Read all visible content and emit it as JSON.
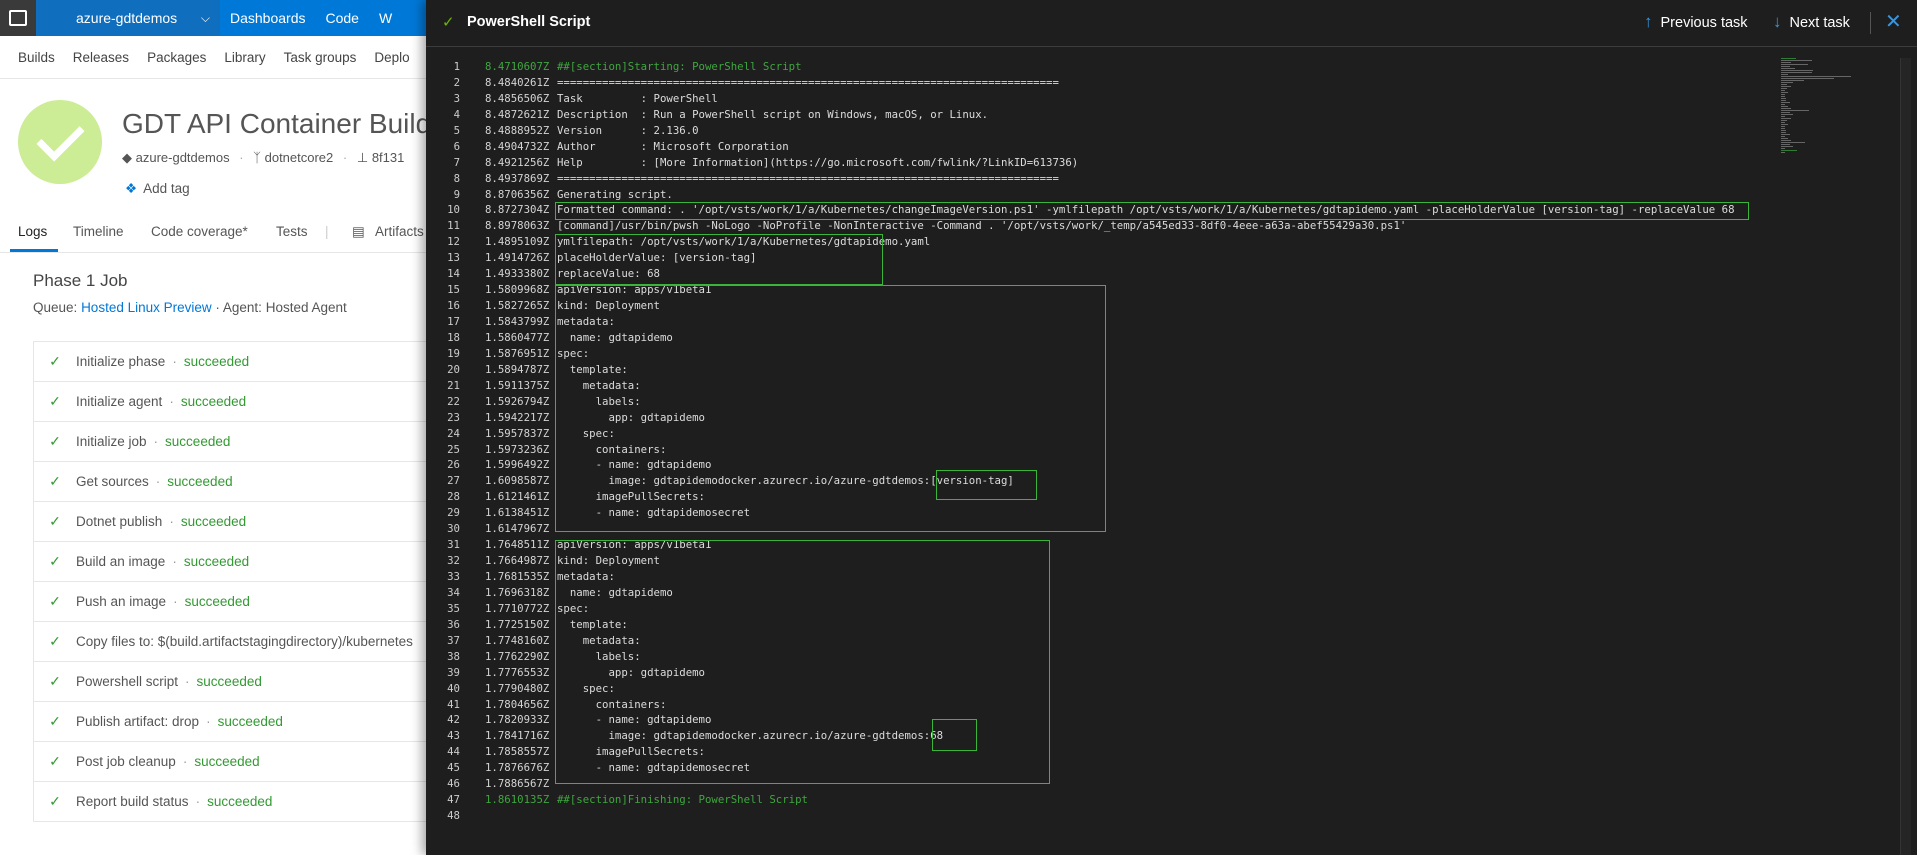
{
  "topbar": {
    "project": "azure-gdtdemos",
    "nav": [
      "Dashboards",
      "Code",
      "W"
    ]
  },
  "subnav": [
    "Builds",
    "Releases",
    "Packages",
    "Library",
    "Task groups",
    "Deplo"
  ],
  "build": {
    "title": "GDT API Container Build",
    "meta_project": "azure-gdtdemos",
    "meta_branch": "dotnetcore2",
    "meta_commit": "8f131",
    "add_tag": "Add tag"
  },
  "tabs": [
    "Logs",
    "Timeline",
    "Code coverage*",
    "Tests",
    "Artifacts"
  ],
  "phase": {
    "title": "Phase 1 Job",
    "queue_label": "Queue:",
    "queue_link": "Hosted Linux Preview",
    "agent": "· Agent: Hosted Agent"
  },
  "tasks": [
    {
      "name": "Initialize phase",
      "status": "succeeded"
    },
    {
      "name": "Initialize agent",
      "status": "succeeded"
    },
    {
      "name": "Initialize job",
      "status": "succeeded"
    },
    {
      "name": "Get sources",
      "status": "succeeded"
    },
    {
      "name": "Dotnet publish",
      "status": "succeeded"
    },
    {
      "name": "Build an image",
      "status": "succeeded"
    },
    {
      "name": "Push an image",
      "status": "succeeded"
    },
    {
      "name": "Copy files to: $(build.artifactstagingdirectory)/kubernetes",
      "status": ""
    },
    {
      "name": "Powershell script",
      "status": "succeeded"
    },
    {
      "name": "Publish artifact: drop",
      "status": "succeeded"
    },
    {
      "name": "Post job cleanup",
      "status": "succeeded"
    },
    {
      "name": "Report build status",
      "status": "succeeded"
    }
  ],
  "log_panel": {
    "title": "PowerShell Script",
    "prev_task": "Previous task",
    "next_task": "Next task",
    "lines": [
      {
        "n": "1",
        "ts": "8.4710607Z",
        "text": "##[section]Starting: PowerShell Script",
        "section": true
      },
      {
        "n": "2",
        "ts": "8.4840261Z",
        "text": "=============================================================================="
      },
      {
        "n": "3",
        "ts": "8.4856506Z",
        "text": "Task         : PowerShell"
      },
      {
        "n": "4",
        "ts": "8.4872621Z",
        "text": "Description  : Run a PowerShell script on Windows, macOS, or Linux."
      },
      {
        "n": "5",
        "ts": "8.4888952Z",
        "text": "Version      : 2.136.0"
      },
      {
        "n": "6",
        "ts": "8.4904732Z",
        "text": "Author       : Microsoft Corporation"
      },
      {
        "n": "7",
        "ts": "8.4921256Z",
        "text": "Help         : [More Information](https://go.microsoft.com/fwlink/?LinkID=613736)"
      },
      {
        "n": "8",
        "ts": "8.4937869Z",
        "text": "=============================================================================="
      },
      {
        "n": "9",
        "ts": "8.8706356Z",
        "text": "Generating script."
      },
      {
        "n": "10",
        "ts": "8.8727304Z",
        "text": "Formatted command: . '/opt/vsts/work/1/a/Kubernetes/changeImageVersion.ps1' -ymlfilepath /opt/vsts/work/1/a/Kubernetes/gdtapidemo.yaml -placeHolderValue [version-tag] -replaceValue 68"
      },
      {
        "n": "11",
        "ts": "8.8978063Z",
        "text": "[command]/usr/bin/pwsh -NoLogo -NoProfile -NonInteractive -Command . '/opt/vsts/work/_temp/a545ed33-8df0-4eee-a63a-abef55429a30.ps1'"
      },
      {
        "n": "12",
        "ts": "1.4895109Z",
        "text": "ymlfilepath: /opt/vsts/work/1/a/Kubernetes/gdtapidemo.yaml"
      },
      {
        "n": "13",
        "ts": "1.4914726Z",
        "text": "placeHolderValue: [version-tag]"
      },
      {
        "n": "14",
        "ts": "1.4933380Z",
        "text": "replaceValue: 68"
      },
      {
        "n": "15",
        "ts": "1.5809968Z",
        "text": "apiVersion: apps/v1beta1"
      },
      {
        "n": "16",
        "ts": "1.5827265Z",
        "text": "kind: Deployment"
      },
      {
        "n": "17",
        "ts": "1.5843799Z",
        "text": "metadata:"
      },
      {
        "n": "18",
        "ts": "1.5860477Z",
        "text": "  name: gdtapidemo"
      },
      {
        "n": "19",
        "ts": "1.5876951Z",
        "text": "spec:"
      },
      {
        "n": "20",
        "ts": "1.5894787Z",
        "text": "  template:"
      },
      {
        "n": "21",
        "ts": "1.5911375Z",
        "text": "    metadata:"
      },
      {
        "n": "22",
        "ts": "1.5926794Z",
        "text": "      labels:"
      },
      {
        "n": "23",
        "ts": "1.5942217Z",
        "text": "        app: gdtapidemo"
      },
      {
        "n": "24",
        "ts": "1.5957837Z",
        "text": "    spec:"
      },
      {
        "n": "25",
        "ts": "1.5973236Z",
        "text": "      containers:"
      },
      {
        "n": "26",
        "ts": "1.5996492Z",
        "text": "      - name: gdtapidemo"
      },
      {
        "n": "27",
        "ts": "1.6098587Z",
        "text": "        image: gdtapidemodocker.azurecr.io/azure-gdtdemos:[version-tag]"
      },
      {
        "n": "28",
        "ts": "1.6121461Z",
        "text": "      imagePullSecrets:"
      },
      {
        "n": "29",
        "ts": "1.6138451Z",
        "text": "      - name: gdtapidemosecret"
      },
      {
        "n": "30",
        "ts": "1.6147967Z",
        "text": ""
      },
      {
        "n": "31",
        "ts": "1.7648511Z",
        "text": "apiVersion: apps/v1beta1"
      },
      {
        "n": "32",
        "ts": "1.7664987Z",
        "text": "kind: Deployment"
      },
      {
        "n": "33",
        "ts": "1.7681535Z",
        "text": "metadata:"
      },
      {
        "n": "34",
        "ts": "1.7696318Z",
        "text": "  name: gdtapidemo"
      },
      {
        "n": "35",
        "ts": "1.7710772Z",
        "text": "spec:"
      },
      {
        "n": "36",
        "ts": "1.7725150Z",
        "text": "  template:"
      },
      {
        "n": "37",
        "ts": "1.7748160Z",
        "text": "    metadata:"
      },
      {
        "n": "38",
        "ts": "1.7762290Z",
        "text": "      labels:"
      },
      {
        "n": "39",
        "ts": "1.7776553Z",
        "text": "        app: gdtapidemo"
      },
      {
        "n": "40",
        "ts": "1.7790480Z",
        "text": "    spec:"
      },
      {
        "n": "41",
        "ts": "1.7804656Z",
        "text": "      containers:"
      },
      {
        "n": "42",
        "ts": "1.7820933Z",
        "text": "      - name: gdtapidemo"
      },
      {
        "n": "43",
        "ts": "1.7841716Z",
        "text": "        image: gdtapidemodocker.azurecr.io/azure-gdtdemos:68"
      },
      {
        "n": "44",
        "ts": "1.7858557Z",
        "text": "      imagePullSecrets:"
      },
      {
        "n": "45",
        "ts": "1.7876676Z",
        "text": "      - name: gdtapidemosecret"
      },
      {
        "n": "46",
        "ts": "1.7886567Z",
        "text": ""
      },
      {
        "n": "47",
        "ts": "1.8610135Z",
        "text": "##[section]Finishing: PowerShell Script",
        "section": true
      },
      {
        "n": "48",
        "ts": "",
        "text": ""
      }
    ]
  }
}
